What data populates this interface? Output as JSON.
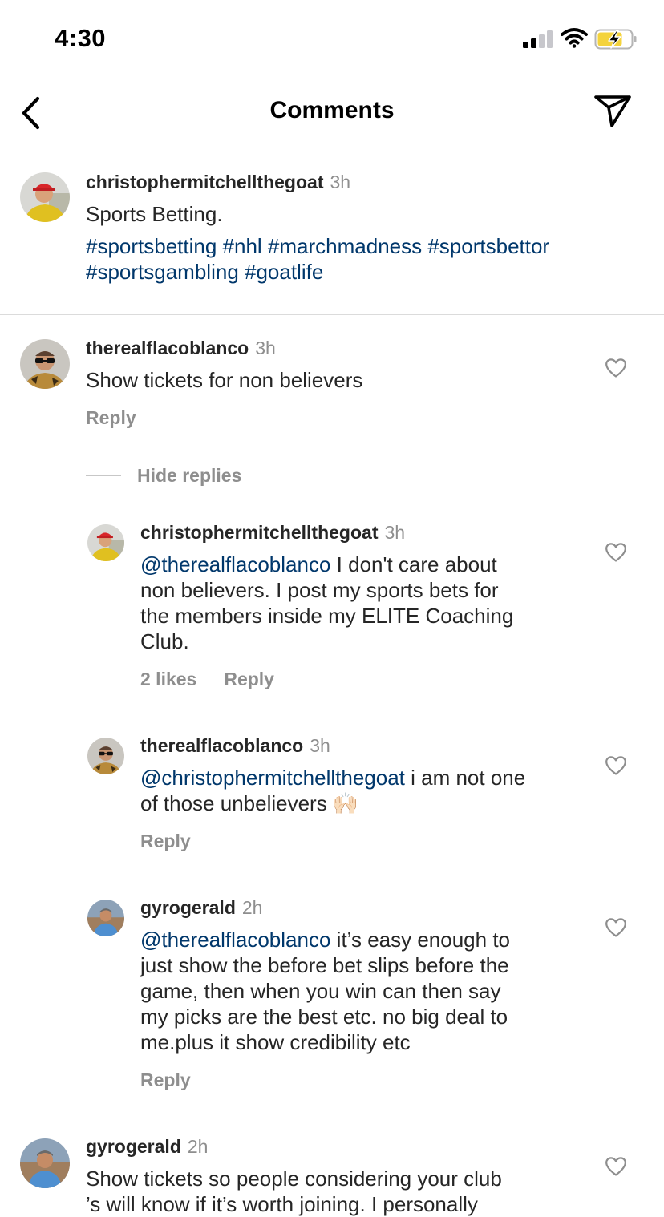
{
  "status_bar": {
    "time": "4:30"
  },
  "header": {
    "title": "Comments"
  },
  "caption": {
    "username": "christophermitchellthegoat",
    "timestamp": "3h",
    "text": "Sports Betting.",
    "hashtags_line1": "#sportsbetting #nhl #marchmadness #sportsbettor",
    "hashtags_line2": "#sportsgambling #goatlife"
  },
  "comments": [
    {
      "username": "therealflacoblanco",
      "timestamp": "3h",
      "text": "Show tickets for non believers",
      "reply_label": "Reply"
    }
  ],
  "hide_replies": "Hide replies",
  "replies": [
    {
      "username": "christophermitchellthegoat",
      "timestamp": "3h",
      "mention": "@therealflacoblanco",
      "text_lines": [
        " I don't care about",
        "non believers. I post my sports bets for",
        "the members inside my ELITE Coaching",
        "Club."
      ],
      "likes": "2 likes",
      "reply_label": "Reply"
    },
    {
      "username": "therealflacoblanco",
      "timestamp": "3h",
      "mention": "@christophermitchellthegoat",
      "text_lines": [
        " i am not one",
        "of those unbelievers 🙌🏻"
      ],
      "reply_label": "Reply"
    },
    {
      "username": "gyrogerald",
      "timestamp": "2h",
      "mention": "@therealflacoblanco",
      "text_lines": [
        " it’s easy enough to",
        "just show the before bet slips before the",
        "game, then when you win can then say",
        "my picks are the best etc. no big deal to",
        "me.plus it show credibility etc"
      ],
      "reply_label": "Reply"
    }
  ],
  "last_comment": {
    "username": "gyrogerald",
    "timestamp": "2h",
    "text_line1": "Show tickets so people considering your club",
    "text_line2": "’s will know if it’s worth joining.  I personally"
  },
  "colors": {
    "text": "#262626",
    "secondary": "#8e8e8e",
    "link": "#00376b",
    "divider": "#dbdbdb",
    "battery_fill": "#f4d33c"
  },
  "icons": [
    "back-chevron-icon",
    "send-icon",
    "heart-icon",
    "cellular-signal-icon",
    "wifi-icon",
    "battery-charging-icon"
  ]
}
